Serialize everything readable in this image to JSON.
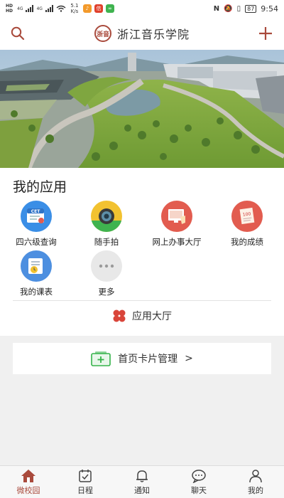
{
  "status_bar": {
    "network_badges": [
      "HD",
      "HD"
    ],
    "speed": "5.1 K/s",
    "signal_labels": [
      "4G",
      "4G"
    ],
    "battery": "87",
    "time": "9:54"
  },
  "header": {
    "title": "浙江音乐学院",
    "logo_text": "浙音"
  },
  "apps": {
    "section_title": "我的应用",
    "items": [
      {
        "label": "四六级查询",
        "icon": "cet-icon",
        "color": "#3a8ee6",
        "badge": "CET"
      },
      {
        "label": "随手拍",
        "icon": "camera-icon",
        "color": "#f2c230"
      },
      {
        "label": "网上办事大厅",
        "icon": "online-hall-icon",
        "color": "#e25c4f"
      },
      {
        "label": "我的成绩",
        "icon": "score-icon",
        "color": "#e25c4f",
        "badge": "100"
      },
      {
        "label": "我的课表",
        "icon": "timetable-icon",
        "color": "#4d8fe0"
      },
      {
        "label": "更多",
        "icon": "more-icon",
        "color": "#e8e8e8"
      }
    ],
    "app_store_label": "应用大厅"
  },
  "card_manage": {
    "label": "首页卡片管理",
    "chevron": ">"
  },
  "tabbar": {
    "tabs": [
      {
        "label": "微校园",
        "icon": "home-icon",
        "active": true
      },
      {
        "label": "日程",
        "icon": "calendar-icon",
        "active": false
      },
      {
        "label": "通知",
        "icon": "bell-icon",
        "active": false
      },
      {
        "label": "聊天",
        "icon": "chat-icon",
        "active": false
      },
      {
        "label": "我的",
        "icon": "user-icon",
        "active": false
      }
    ]
  },
  "colors": {
    "accent": "#a94a3c",
    "card_green": "#35b34a"
  }
}
